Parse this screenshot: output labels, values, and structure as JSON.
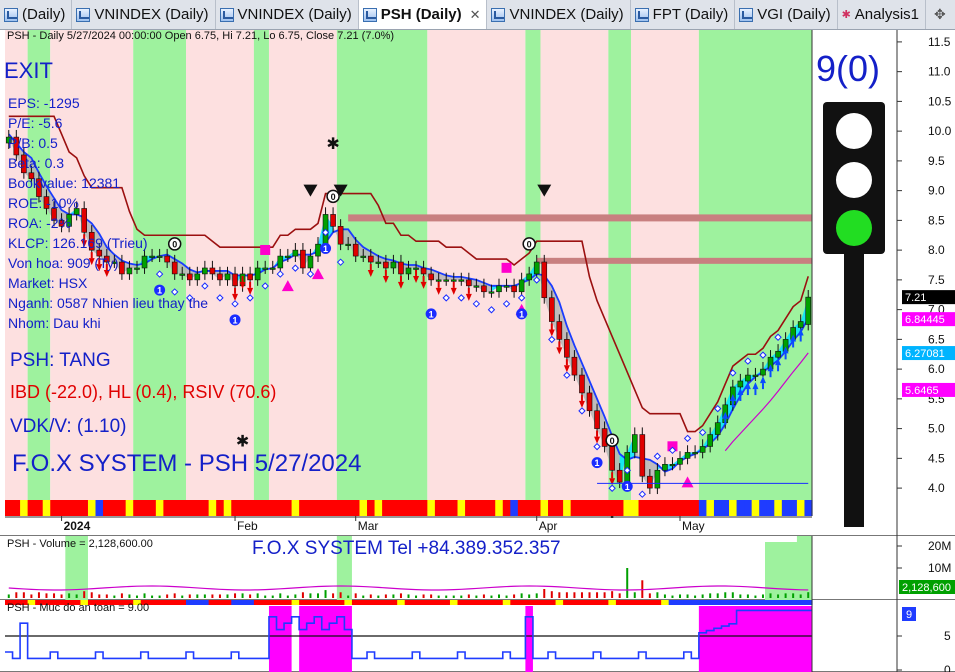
{
  "tabs": [
    {
      "label": "(Daily)",
      "icon": "chart-icon",
      "active": false
    },
    {
      "label": "VNINDEX (Daily)",
      "icon": "chart-icon",
      "active": false
    },
    {
      "label": "VNINDEX (Daily)",
      "icon": "chart-icon",
      "active": false
    },
    {
      "label": "PSH (Daily)",
      "icon": "chart-icon",
      "active": true
    },
    {
      "label": "VNINDEX (Daily)",
      "icon": "chart-icon",
      "active": false
    },
    {
      "label": "FPT (Daily)",
      "icon": "chart-icon",
      "active": false
    },
    {
      "label": "VGI (Daily)",
      "icon": "chart-icon",
      "active": false
    },
    {
      "label": "Analysis1",
      "icon": "analysis-icon",
      "active": false
    }
  ],
  "tab_close_glyph": "✕",
  "main": {
    "info_line": "PSH - Daily 5/27/2024 00:00:00 Open 6.75, Hi 7.21, Lo 6.75, Close 7.21 (7.0%)",
    "exit_label": "EXIT",
    "fundamentals": [
      "EPS: -1295",
      "P/E: -5.6",
      "P/B: 0.5",
      "Beta: 0.3",
      "Bookvalue: 12381",
      "ROE: -10%",
      "ROA: -2%",
      "KLCP: 126.169 (Trieu)",
      "Von hoa: 909 (Ty)",
      "Market: HSX",
      "Nganh: 0587 Nhien lieu thay the",
      "Nhom: Dau khi"
    ],
    "trend": "PSH: TANG",
    "ibd": "IBD (-22.0), HL (0.4), RSIV (70.6)",
    "vdk": "VDK/V:  (1.10)",
    "title": "F.O.X SYSTEM - PSH 5/27/2024",
    "score": "9(0)",
    "price_labels": [
      {
        "text": "7.21",
        "bg": "#000000",
        "fg": "#ffffff",
        "value": 7.21
      },
      {
        "text": "6.84445",
        "bg": "#ff00ff",
        "fg": "#ffffff",
        "value": 6.84
      },
      {
        "text": "6.27081",
        "bg": "#00b4ff",
        "fg": "#ffffff",
        "value": 6.27
      },
      {
        "text": "5.6465",
        "bg": "#ff00ff",
        "fg": "#ffffff",
        "value": 5.65
      }
    ]
  },
  "volume": {
    "info": "PSH - Volume = 2,128,600.00",
    "tel": "F.O.X SYSTEM Tel +84.389.352.357",
    "label": "2,128,600",
    "ticks": [
      "20M",
      "10M"
    ]
  },
  "safety": {
    "info": "PSH - Muc do an toan = 9.00",
    "label": "9",
    "ticks": [
      "5",
      "0"
    ]
  },
  "colors": {
    "uptrend_band": "#9ef29e",
    "downtrend_band": "#fde0e0",
    "stop_line": "#9b1010",
    "trail_line": "#1a3cff",
    "cloud": "#00e5ff",
    "resistance": "#c88080",
    "traffic_green": "#22dd22"
  },
  "chart_data": {
    "type": "candlestick",
    "symbol": "PSH",
    "interval": "Daily",
    "ylim": [
      3.8,
      11.7
    ],
    "yticks": [
      4.0,
      4.5,
      5.0,
      5.5,
      6.0,
      6.5,
      7.0,
      7.5,
      8.0,
      8.5,
      9.0,
      9.5,
      10.0,
      10.5,
      11.0,
      11.5
    ],
    "x_labels": [
      {
        "text": "2024",
        "index": 7
      },
      {
        "text": "Feb",
        "index": 30
      },
      {
        "text": "Mar",
        "index": 46
      },
      {
        "text": "Apr",
        "index": 70
      },
      {
        "text": "May",
        "index": 89
      }
    ],
    "close": [
      9.9,
      9.6,
      9.3,
      9.2,
      8.9,
      8.7,
      8.5,
      8.4,
      8.6,
      8.7,
      8.3,
      8.0,
      7.9,
      7.8,
      7.8,
      7.6,
      7.7,
      7.7,
      7.9,
      7.9,
      7.9,
      7.8,
      7.6,
      7.6,
      7.5,
      7.6,
      7.7,
      7.6,
      7.5,
      7.6,
      7.4,
      7.6,
      7.5,
      7.7,
      7.7,
      7.7,
      7.9,
      7.9,
      8.0,
      7.7,
      7.9,
      8.1,
      8.6,
      8.4,
      8.1,
      8.1,
      7.9,
      7.9,
      7.8,
      7.8,
      7.7,
      7.8,
      7.6,
      7.7,
      7.7,
      7.6,
      7.5,
      7.5,
      7.5,
      7.5,
      7.5,
      7.4,
      7.4,
      7.3,
      7.3,
      7.4,
      7.4,
      7.3,
      7.5,
      7.6,
      7.8,
      7.2,
      6.8,
      6.5,
      6.2,
      5.9,
      5.6,
      5.3,
      5.0,
      4.7,
      4.3,
      4.1,
      4.6,
      4.9,
      4.2,
      4.0,
      4.3,
      4.4,
      4.4,
      4.5,
      4.6,
      4.6,
      4.7,
      4.9,
      5.1,
      5.4,
      5.7,
      5.8,
      5.9,
      5.9,
      6.0,
      6.2,
      6.3,
      6.5,
      6.7,
      6.8,
      7.21
    ],
    "open": [
      9.8,
      9.9,
      9.6,
      9.3,
      9.2,
      8.9,
      8.7,
      8.5,
      8.4,
      8.6,
      8.7,
      8.3,
      8.0,
      7.9,
      7.8,
      7.8,
      7.6,
      7.7,
      7.7,
      7.9,
      7.9,
      7.9,
      7.8,
      7.6,
      7.6,
      7.5,
      7.6,
      7.7,
      7.6,
      7.5,
      7.6,
      7.4,
      7.6,
      7.5,
      7.7,
      7.7,
      7.7,
      7.9,
      7.9,
      8.0,
      7.7,
      7.9,
      8.1,
      8.6,
      8.4,
      8.1,
      8.1,
      7.9,
      7.9,
      7.8,
      7.8,
      7.7,
      7.8,
      7.6,
      7.7,
      7.7,
      7.6,
      7.5,
      7.5,
      7.5,
      7.5,
      7.5,
      7.4,
      7.4,
      7.3,
      7.3,
      7.4,
      7.4,
      7.3,
      7.5,
      7.6,
      7.8,
      7.2,
      6.8,
      6.5,
      6.2,
      5.9,
      5.6,
      5.3,
      5.0,
      4.7,
      4.3,
      4.1,
      4.6,
      4.9,
      4.2,
      4.0,
      4.3,
      4.4,
      4.4,
      4.5,
      4.6,
      4.6,
      4.7,
      4.9,
      5.1,
      5.4,
      5.7,
      5.8,
      5.9,
      5.9,
      6.0,
      6.2,
      6.3,
      6.5,
      6.7,
      6.75
    ],
    "last_bar": {
      "date": "5/27/2024",
      "open": 6.75,
      "high": 7.21,
      "low": 6.75,
      "close": 7.21,
      "change_pct": 7.0
    },
    "resistance_levels": [
      8.55,
      7.82
    ],
    "volume_last": 2128600,
    "safety_last": 9.0,
    "safety_ylim": [
      0,
      10
    ],
    "volume_ylim": [
      0,
      22000000
    ]
  }
}
